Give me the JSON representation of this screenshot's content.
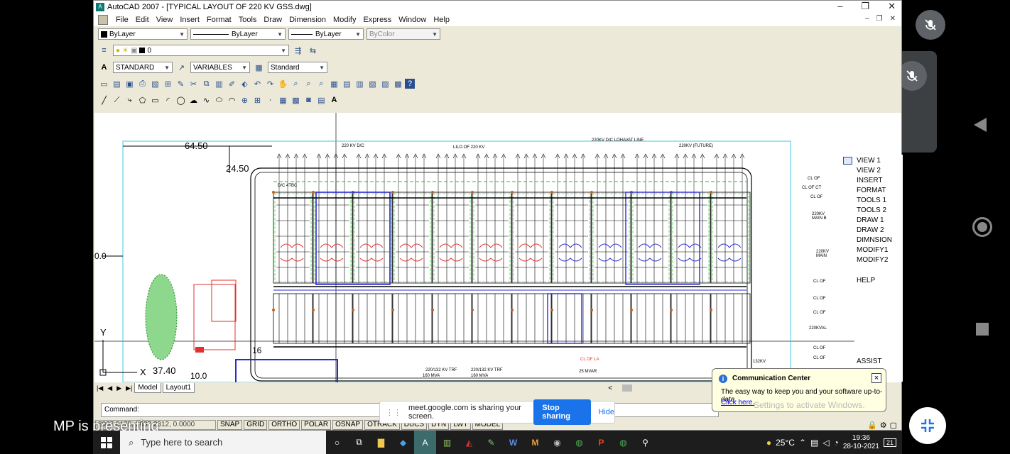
{
  "window": {
    "title": "AutoCAD 2007 - [TYPICAL LAYOUT OF 220 KV GSS.dwg]",
    "controls": [
      "–",
      "❐",
      "✕"
    ]
  },
  "menubar": [
    "File",
    "Edit",
    "View",
    "Insert",
    "Format",
    "Tools",
    "Draw",
    "Dimension",
    "Modify",
    "Express",
    "Window",
    "Help"
  ],
  "properties": {
    "color": "ByLayer",
    "linetype": "ByLayer",
    "lineweight": "ByLayer",
    "plotstyle": "ByColor"
  },
  "layers": {
    "current": "0"
  },
  "styles": {
    "text": "STANDARD",
    "dim": "VARIABLES",
    "table": "Standard"
  },
  "drawing": {
    "dims": [
      "64.50",
      "24.50",
      "0.0",
      "37.40",
      "10.0",
      "16"
    ],
    "axis_y": "Y",
    "axis_x": "X",
    "labels": [
      "220 KV D/C",
      "LILO OF 220 KV",
      "220KV D/C LOHAVAT LINE",
      "220KV (FUTURE)",
      "D/C 4TBC",
      "220/132 KV TRF",
      "220/132 KV TRF",
      "160 MVA",
      "160 MVA",
      "25 MVAR",
      "CL OF LA",
      "132KV"
    ],
    "right_labels": [
      "CL OF",
      "CL OF CT",
      "CL OF",
      "220KV MAIN B",
      "220KV MAIN",
      "CL OF",
      "CL OF",
      "CL OF",
      "220KVAL",
      "CL OF",
      "CL OF"
    ]
  },
  "right_menu": [
    "VIEW 1",
    "VIEW 2",
    "INSERT",
    "FORMAT",
    "TOOLS 1",
    "TOOLS 2",
    "DRAW 1",
    "DRAW 2",
    "DIMNSION",
    "MODIFY1",
    "MODIFY2",
    "HELP",
    "ASSIST"
  ],
  "layout_tabs": [
    "Model",
    "Layout1"
  ],
  "command": {
    "prompt": "Command:"
  },
  "status": {
    "coords": "8037.0175, 2637.2312, 0.0000",
    "buttons": [
      "SNAP",
      "GRID",
      "ORTHO",
      "POLAR",
      "OSNAP",
      "OTRACK",
      "DUCS",
      "DYN",
      "LWT",
      "MODEL"
    ]
  },
  "comm_center": {
    "title": "Communication Center",
    "message": "The easy way to keep you and your software up-to-date.",
    "link": "Click here.",
    "activate": "Settings to activate Windows."
  },
  "share": {
    "message": "meet.google.com is sharing your screen.",
    "stop": "Stop sharing",
    "hide": "Hide"
  },
  "presenter": "MP is presenting",
  "taskbar": {
    "search_placeholder": "Type here to search",
    "temperature": "25°C",
    "time": "19:36",
    "date": "28-10-2021",
    "notifications": "21"
  },
  "colors": {
    "accent_blue": "#1a73e8",
    "cad_red": "#e03030",
    "cad_blue": "#2a2ad0",
    "cad_green": "#20c020"
  }
}
